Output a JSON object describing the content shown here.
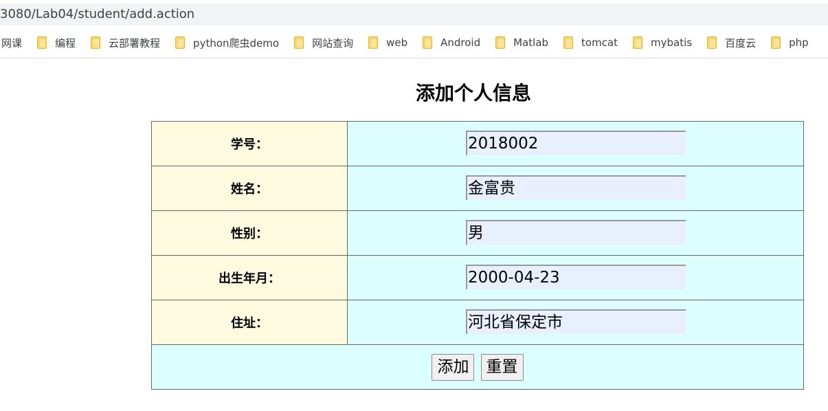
{
  "browser": {
    "url": "3080/Lab04/student/add.action"
  },
  "bookmarks": [
    {
      "label": "网课",
      "icon": "none"
    },
    {
      "label": "编程",
      "icon": "folder-icon"
    },
    {
      "label": "云部署教程",
      "icon": "folder-icon"
    },
    {
      "label": "python爬虫demo",
      "icon": "folder-icon"
    },
    {
      "label": "网站查询",
      "icon": "folder-icon"
    },
    {
      "label": "web",
      "icon": "folder-icon"
    },
    {
      "label": "Android",
      "icon": "folder-icon"
    },
    {
      "label": "Matlab",
      "icon": "folder-icon"
    },
    {
      "label": "tomcat",
      "icon": "folder-icon"
    },
    {
      "label": "mybatis",
      "icon": "folder-icon"
    },
    {
      "label": "百度云",
      "icon": "folder-icon"
    },
    {
      "label": "php",
      "icon": "folder-icon"
    }
  ],
  "page": {
    "title": "添加个人信息"
  },
  "form": {
    "rows": [
      {
        "label": "学号：",
        "value": "2018002"
      },
      {
        "label": "姓名：",
        "value": "金富贵"
      },
      {
        "label": "性别：",
        "value": "男"
      },
      {
        "label": "出生年月：",
        "value": "2000-04-23"
      },
      {
        "label": "住址：",
        "value": "河北省保定市"
      }
    ],
    "submit_label": "添加",
    "reset_label": "重置"
  },
  "colors": {
    "label_bg": "#fdfadf",
    "field_bg": "#dcfefe",
    "input_bg": "#e8f0fe"
  }
}
